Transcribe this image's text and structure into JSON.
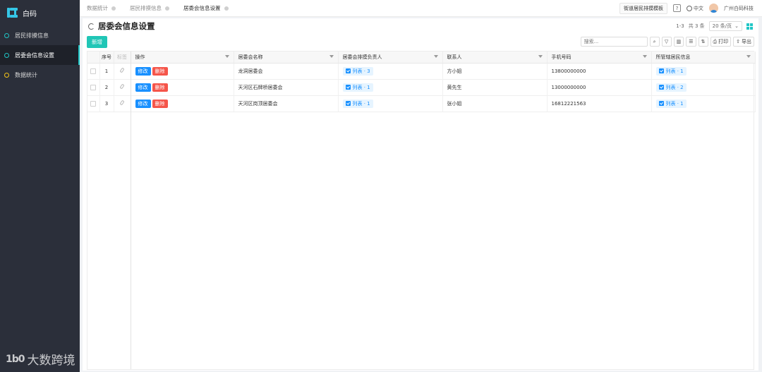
{
  "app": {
    "brand_name": "白码"
  },
  "sidebar": {
    "items": [
      {
        "label": "居民排摸信息"
      },
      {
        "label": "居委会信息设置"
      },
      {
        "label": "数据统计"
      }
    ]
  },
  "watermark": {
    "logo": "1b0",
    "text": "大数跨境"
  },
  "tabs": [
    {
      "label": "数据统计"
    },
    {
      "label": "居民排摸信息"
    },
    {
      "label": "居委会信息设置"
    }
  ],
  "topbar": {
    "template_button": "街道居民排摸模板",
    "help": "?",
    "language": "中文",
    "company": "广州白码科技"
  },
  "page": {
    "title": "居委会信息设置",
    "range_text": "1-3",
    "total_text": "共 3 条",
    "page_size": "20 条/页",
    "add_button": "新增",
    "search_placeholder": "搜索...",
    "print_label": "打印",
    "export_label": "导出"
  },
  "table": {
    "columns": {
      "index": "序号",
      "tag": "标签",
      "actions": "操作",
      "name": "居委会名称",
      "staff": "居委会排摸负责人",
      "contact": "联系人",
      "phone": "手机号码",
      "residents": "所管辖居民信息"
    },
    "edit_label": "修改",
    "delete_label": "删除",
    "rows": [
      {
        "index": "1",
        "name": "龙洞居委会",
        "staff": "列表 · 3",
        "contact": "方小姐",
        "phone": "13800000000",
        "residents": "列表 · 1"
      },
      {
        "index": "2",
        "name": "天河区石牌桥居委会",
        "staff": "列表 · 1",
        "contact": "黄先生",
        "phone": "13000000000",
        "residents": "列表 · 2"
      },
      {
        "index": "3",
        "name": "天河区岗顶居委会",
        "staff": "列表 · 1",
        "contact": "张小姐",
        "phone": "16812221563",
        "residents": "列表 · 1"
      }
    ]
  },
  "colors": {
    "accent": "#20c6b6",
    "primary": "#1890ff",
    "danger": "#f5554a",
    "sidebar": "#2b2f3a"
  }
}
